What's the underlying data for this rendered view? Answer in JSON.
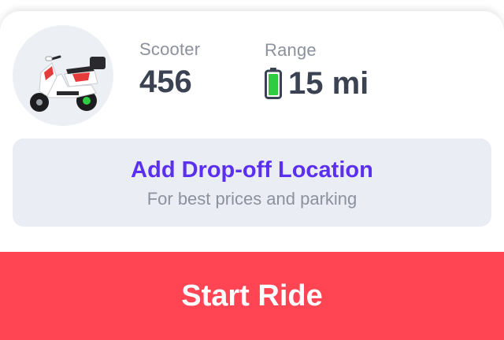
{
  "scooter": {
    "label": "Scooter",
    "value": "456",
    "image_icon": "scooter-photo"
  },
  "range": {
    "label": "Range",
    "value": "15 mi",
    "icon": "battery-icon",
    "battery_color": "#2ecc40"
  },
  "dropoff": {
    "title": "Add Drop-off Location",
    "subtitle": "For best prices and parking"
  },
  "start_ride": {
    "label": "Start Ride"
  },
  "colors": {
    "accent_purple": "#5b2ff0",
    "cta_red": "#ff4554",
    "card_bg": "#eaedf4",
    "muted_text": "#8b919d",
    "value_text": "#3b4352"
  }
}
